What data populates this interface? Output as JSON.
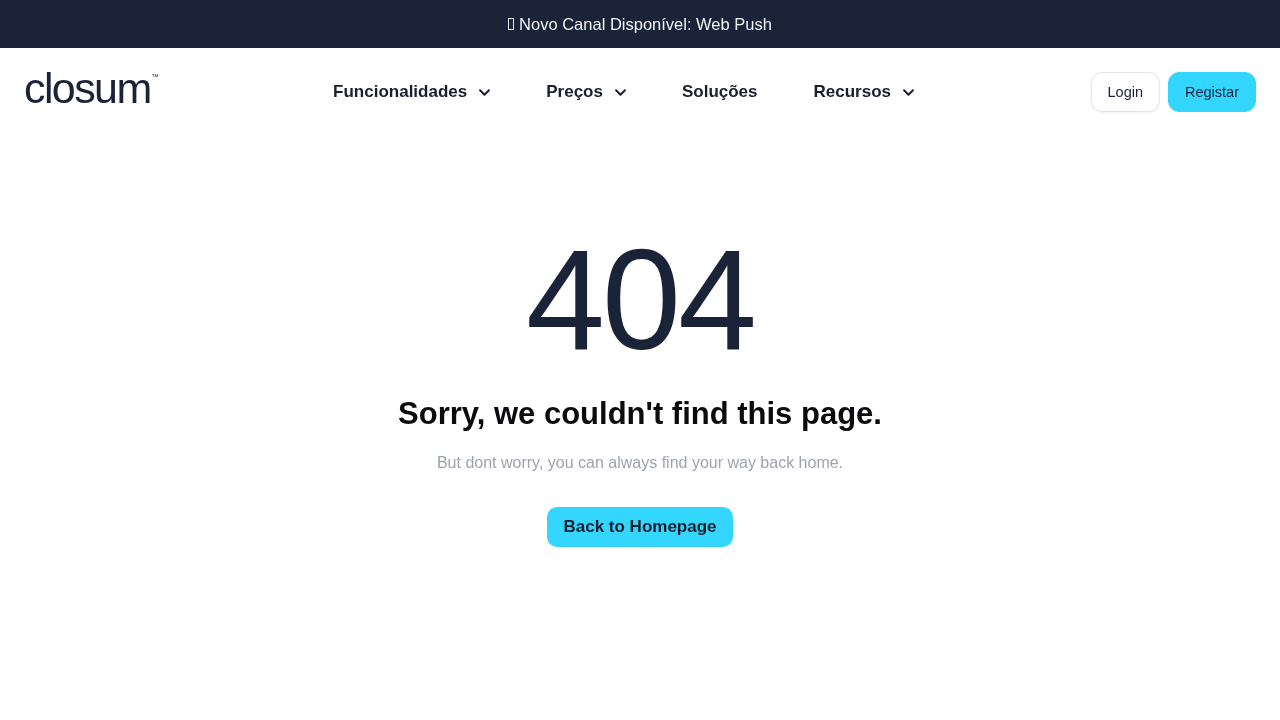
{
  "banner": {
    "text": "Novo Canal Disponível: Web Push"
  },
  "logo": {
    "name": "closum",
    "mark": "™"
  },
  "nav": [
    {
      "label": "Funcionalidades",
      "dropdown": true
    },
    {
      "label": "Preços",
      "dropdown": true
    },
    {
      "label": "Soluções",
      "dropdown": false
    },
    {
      "label": "Recursos",
      "dropdown": true
    }
  ],
  "actions": [
    {
      "label": "Login",
      "kind": "outline"
    },
    {
      "label": "Registar",
      "kind": "primary"
    }
  ],
  "error": {
    "code": "404",
    "title": "Sorry, we couldn't find this page.",
    "message": "But dont worry, you can always find your way back home.",
    "button": "Back to Homepage"
  }
}
